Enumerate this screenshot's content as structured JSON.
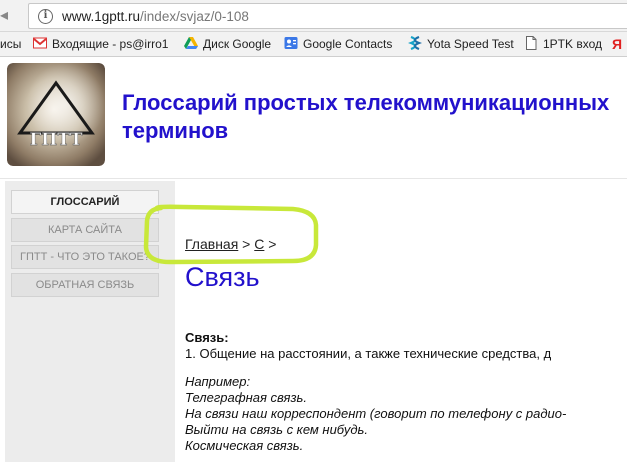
{
  "browser": {
    "url_host": "www.1gptt.ru",
    "url_path": "/index/svjaz/0-108"
  },
  "bookmarks": [
    {
      "label": "исы",
      "icon": "none"
    },
    {
      "label": "Входящие - ps@irro1",
      "icon": "gmail-icon"
    },
    {
      "label": "Диск Google",
      "icon": "google-drive-icon"
    },
    {
      "label": "Google Contacts",
      "icon": "contacts-icon"
    },
    {
      "label": "Yota Speed Test",
      "icon": "yota-icon"
    },
    {
      "label": "1PTK вход",
      "icon": "page-icon"
    },
    {
      "label": "Я",
      "icon": "yandex-icon"
    }
  ],
  "header": {
    "logo_text": "ГПТТ",
    "title": "Глоссарий простых телекоммуникационных терминов"
  },
  "sidebar": {
    "items": [
      {
        "label": "ГЛОССАРИЙ",
        "active": true
      },
      {
        "label": "КАРТА САЙТА",
        "active": false
      },
      {
        "label": "ГПТТ - ЧТО ЭТО ТАКОЕ?",
        "active": false
      },
      {
        "label": "ОБРАТНАЯ СВЯЗЬ",
        "active": false
      }
    ]
  },
  "breadcrumb": {
    "home": "Главная",
    "sep1": " > ",
    "letter": "С",
    "sep2": " >"
  },
  "page_title": "Связь",
  "article": {
    "term": "Связь:",
    "definition": "1. Общение  на расстоянии, а также технические средства, д",
    "examples": [
      "Например:",
      "Телеграфная связь.",
      "На связи наш корреспондент (говорит по телефону с радио-",
      "Выйти на связь с кем нибудь.",
      "Космическая связь."
    ]
  },
  "colors": {
    "title_blue": "#2211cc",
    "highlight_green": "#c8e83a"
  }
}
